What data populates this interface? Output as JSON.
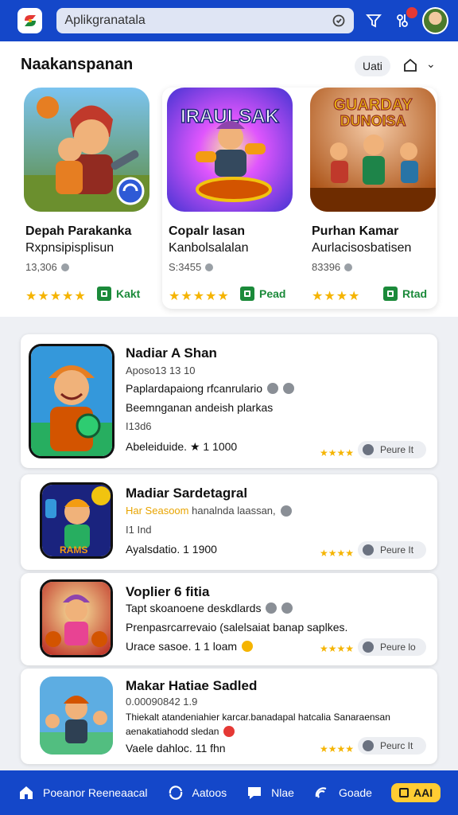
{
  "search": {
    "value": "Aplikgranatala"
  },
  "colors": {
    "brand": "#1447c9",
    "accent": "#ffcc33",
    "install": "#1b8a3a",
    "star": "#f5b400"
  },
  "section": {
    "title": "Naakanspanan",
    "pill": "Uati",
    "more": "⌄"
  },
  "notifications": {
    "badge": ""
  },
  "featured": [
    {
      "title": "Depah Parakanka",
      "subtitle": "Rxpnsipisplisun",
      "meta": "13,306",
      "stars": "★★★★★",
      "action": "Kakt"
    },
    {
      "title": "Copalr lasan",
      "subtitle": "Kanbolsalalan",
      "meta": "S:3455",
      "stars": "★★★★★",
      "action": "Pead",
      "art_text": "IRAULSAK"
    },
    {
      "title": "Purhan Kamar",
      "subtitle": "Aurlacisosbatisen",
      "meta": "83396",
      "stars": "★★★★",
      "action": "Rtad",
      "art_text_1": "GUARDAY",
      "art_text_2": "DUNOISA"
    }
  ],
  "list": [
    {
      "title": "Nadiar A Shan",
      "line1": "Aposo13 13 10",
      "line2": "Paplardapaiong rfcanrulario",
      "line3": "Beemnganan andeish plarkas",
      "line4": "I13d6",
      "line5": "Abeleiduide. ★ 1 1000",
      "stars": "★★★★",
      "action": "Peure It"
    },
    {
      "title": "Madiar Sardetagral",
      "line1_hl": "Har Seasoom",
      "line1": "hanalnda laassan,",
      "line2": "I1 Ind",
      "line3": "Ayalsdatio. 1 1900",
      "stars": "★★★★",
      "action": "Peure It",
      "art_text": "RAMS"
    },
    {
      "title": "Voplier 6 fitia",
      "line1": "Tapt skoanoene deskdlards",
      "line2": "Prenpasrcarrevaio (salelsaiat banap saplkes.",
      "line3": "Urace sasoe. 1 1 loam",
      "stars": "★★★★",
      "action": "Peure lo"
    },
    {
      "title": "Makar Hatiae Sadled",
      "line1": "0.00090842 1.9",
      "line2": "Thiekalt atandeniahier karcar.banadapal hatcalia Sanaraensan",
      "line3": "aenakatiahodd sledan",
      "line4": "Vaele dahloc. 11 fhn",
      "stars": "★★★★",
      "action": "Peurc It"
    }
  ],
  "nav": {
    "home": "Poeanor Reeneaacal",
    "item2": "Aatoos",
    "item3": "Nlae",
    "item4": "Goade",
    "cta": "AAI"
  }
}
